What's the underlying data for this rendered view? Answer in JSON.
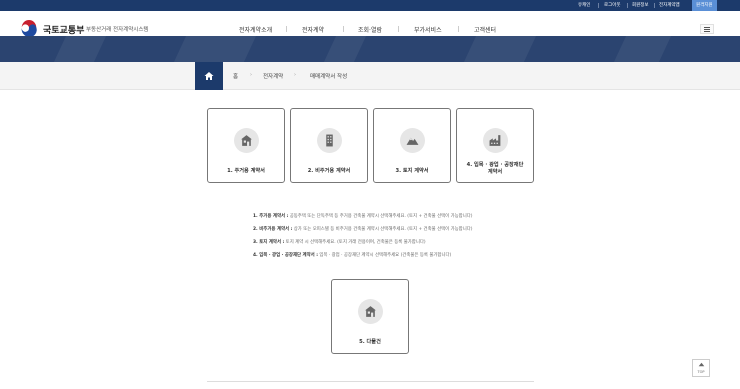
{
  "util": {
    "items": [
      "유캐인",
      "로그아웃",
      "회원정보",
      "전자계약앱",
      "원격지원"
    ]
  },
  "header": {
    "logo_text": "국토교통부",
    "logo_sub": "부동산거래 전자계약시스템",
    "nav": [
      "전자계약소개",
      "전자계약",
      "조회·열람",
      "부가서비스",
      "고객센터"
    ]
  },
  "breadcrumb": [
    "홈",
    "전자계약",
    "매매계약서 작성"
  ],
  "cards": [
    {
      "label": "1. 주거용 계약서",
      "icon": "house-icon"
    },
    {
      "label": "2. 비주거용 계약서",
      "icon": "building-icon"
    },
    {
      "label": "3. 토지 계약서",
      "icon": "mountain-icon"
    },
    {
      "label_line1": "4. 입목 · 광업 · 공장재단",
      "label_line2": "계약서",
      "icon": "factory-icon"
    }
  ],
  "descriptions": [
    {
      "title": "1. 주거용 계약서 :",
      "text": " 공동주택 또는 단독주택 등 주거용 건축물 계약시 선택해주세요. (토지 + 건축물 선택이 가능합니다)"
    },
    {
      "title": "2. 비주거용 계약서 :",
      "text": " 상가 또는 오피스텔 등 비주거용 건축물 계약시 선택해주세요. (토지 + 건축물 선택이 가능합니다)"
    },
    {
      "title": "3. 토지 계약서 :",
      "text": " 토지 계약 시 선택해주세요. (토지 거래 전용이며, 건축물은 등록 불가합니다)"
    },
    {
      "title": "4. 입목 · 광업 · 공장재단 계약서 :",
      "text": " 입목 · 광업 · 공장재단 계약시 선택해주세요 (건축물은 등록 불가합니다)"
    }
  ],
  "multi_card": {
    "label": "5. 다물건",
    "icon": "house-icon"
  },
  "top_button": "TOP",
  "colors": {
    "navy": "#1c3a6b",
    "accent": "#5a8fd6"
  }
}
